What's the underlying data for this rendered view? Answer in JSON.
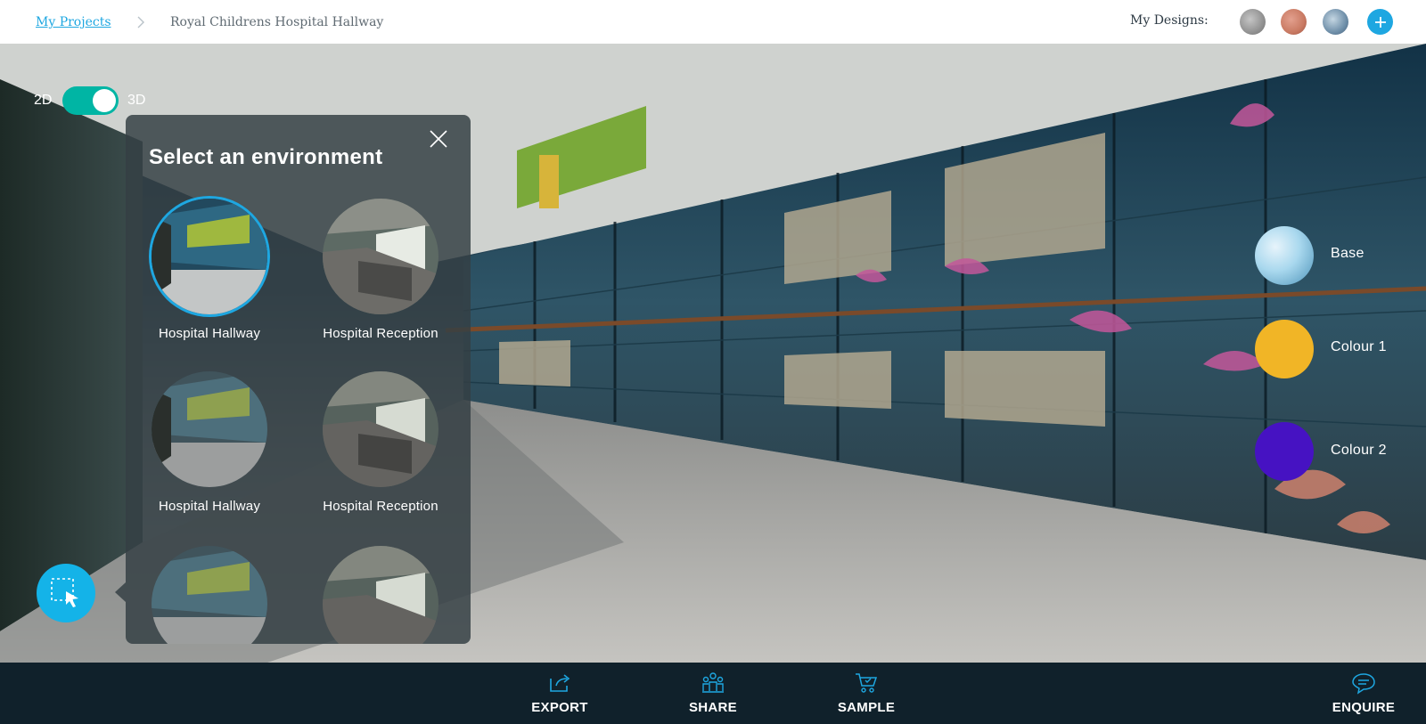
{
  "breadcrumb": {
    "root_label": "My Projects",
    "separator_icon": "chevron-right-icon",
    "current_label": "Royal Childrens Hospital Hallway"
  },
  "designs": {
    "label": "My Designs:",
    "thumbnails": [
      {
        "name": "design-1",
        "color": "#9a9a9a"
      },
      {
        "name": "design-2",
        "color": "#c97a63"
      },
      {
        "name": "design-3",
        "color": "#6f8fa9"
      }
    ],
    "add_icon": "plus-icon"
  },
  "view_toggle": {
    "left_label": "2D",
    "right_label": "3D",
    "state": "3D",
    "color": "#00b5a4"
  },
  "environment_panel": {
    "title": "Select an environment",
    "close_icon": "close-icon",
    "items": [
      {
        "label": "Hospital Hallway",
        "selected": true
      },
      {
        "label": "Hospital Reception",
        "selected": false
      },
      {
        "label": "Hospital Hallway",
        "selected": false
      },
      {
        "label": "Hospital Reception",
        "selected": false
      },
      {
        "label": "",
        "selected": false
      },
      {
        "label": "",
        "selected": false
      }
    ]
  },
  "select_tool": {
    "icon": "select-area-icon",
    "color": "#14b3e8"
  },
  "layers": [
    {
      "label": "Base",
      "color": "#a9d8ee"
    },
    {
      "label": "Colour 1",
      "color": "#f1b526"
    },
    {
      "label": "Colour 2",
      "color": "#4612c2"
    }
  ],
  "actions": {
    "export": {
      "label": "EXPORT",
      "icon": "export-icon"
    },
    "share": {
      "label": "SHARE",
      "icon": "share-icon"
    },
    "sample": {
      "label": "SAMPLE",
      "icon": "cart-icon"
    },
    "enquire": {
      "label": "ENQUIRE",
      "icon": "chat-icon"
    }
  },
  "accent_color": "#1ea7e1"
}
